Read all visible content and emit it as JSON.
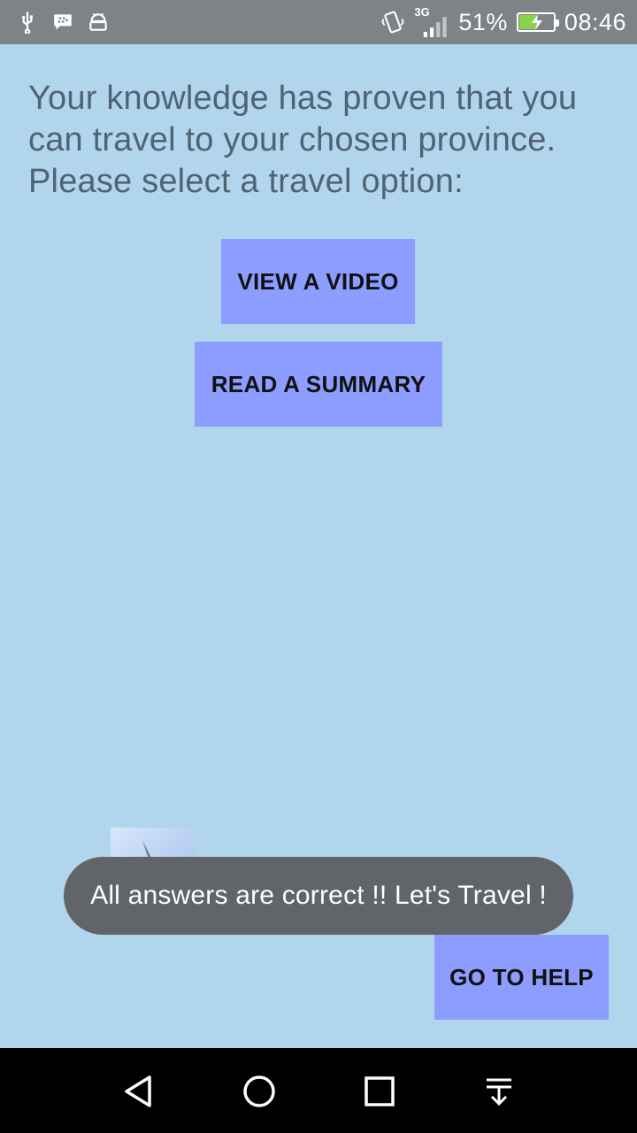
{
  "status_bar": {
    "left_icons": [
      "usb-icon",
      "bbm-icon",
      "android-icon"
    ],
    "network_type": "3G",
    "battery_percent": "51%",
    "battery_level": 0.51,
    "time": "08:46"
  },
  "main": {
    "prompt": "Your knowledge has proven that you can travel to your chosen province. Please select a travel option:",
    "view_video_label": "VIEW A VIDEO",
    "read_summary_label": "READ A SUMMARY",
    "go_to_help_label": "GO TO HELP"
  },
  "toast": {
    "message": "All answers are correct !! Let's Travel !"
  },
  "nav_bar": {
    "icons": [
      "back-icon",
      "home-icon",
      "recents-icon",
      "notification-pull-icon"
    ]
  },
  "colors": {
    "background": "#b2d5ee",
    "button": "#8c9dff",
    "toast": "#616468",
    "status_bar": "#7e8386"
  }
}
